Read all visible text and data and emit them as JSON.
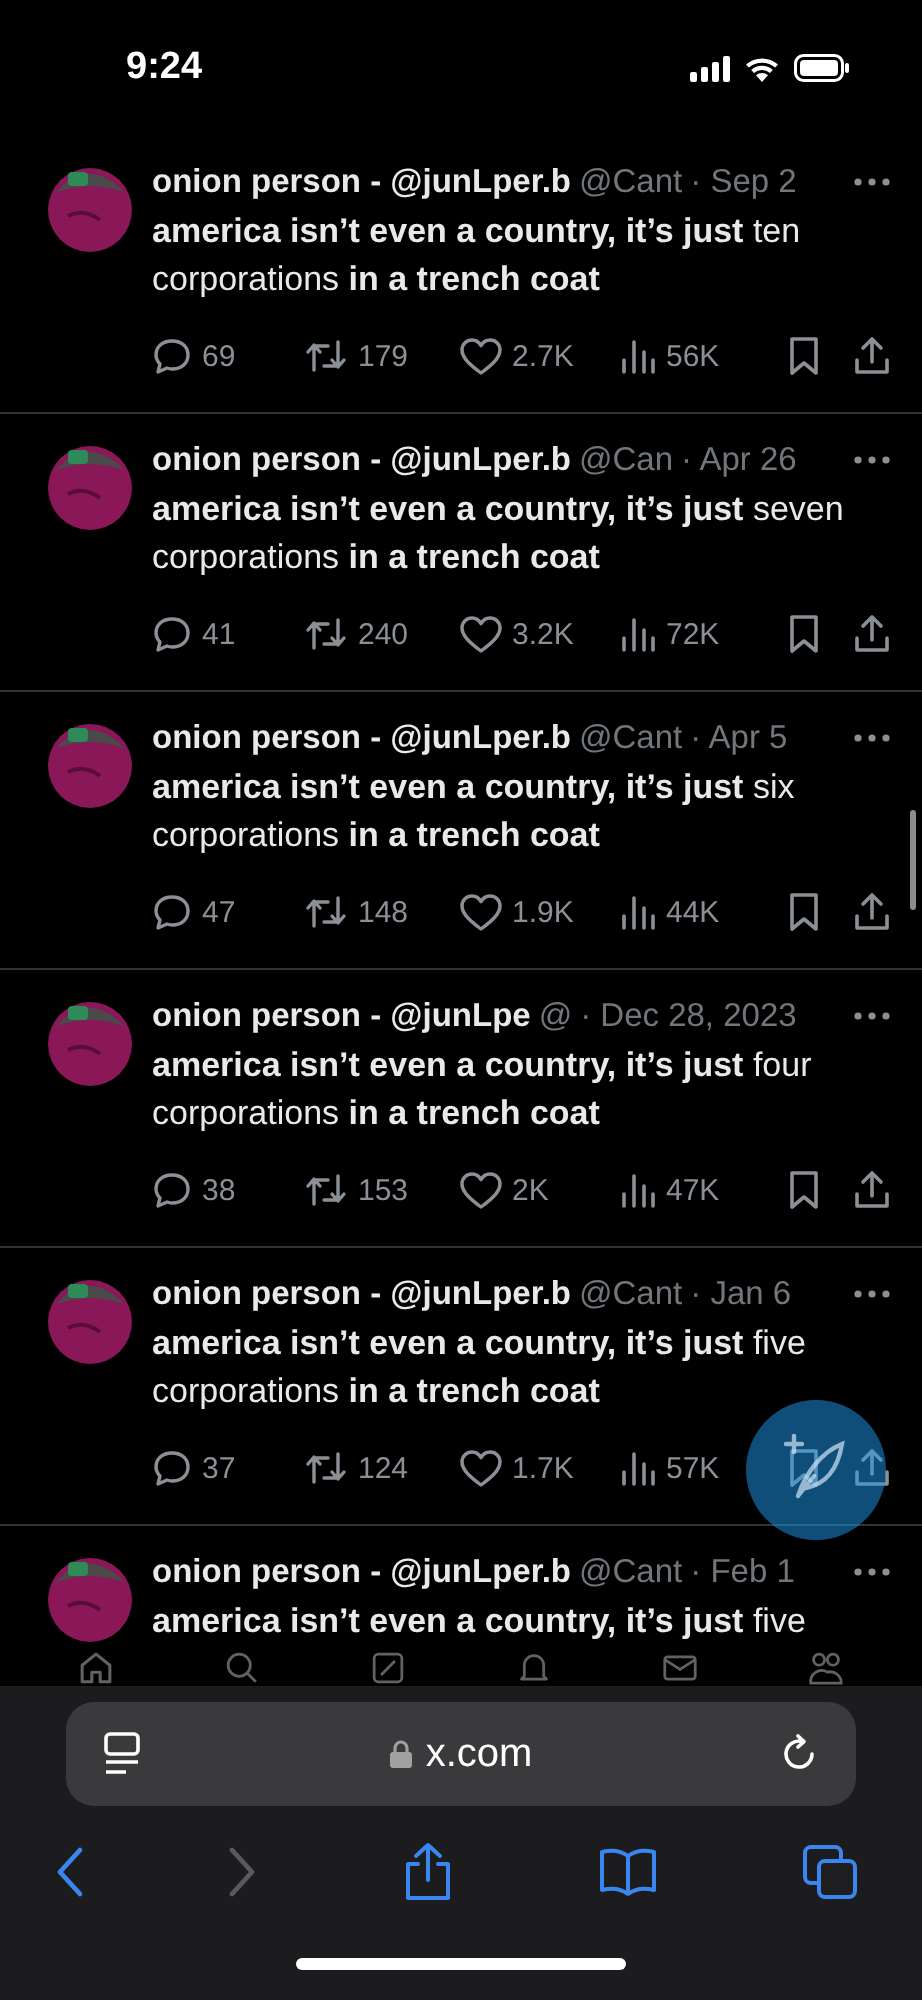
{
  "status_bar": {
    "time": "9:24"
  },
  "tweets": [
    {
      "name": "onion person - @junLper.b",
      "handle": "@Cant",
      "date": "· Sep 2",
      "text": "**america isn’t even a country, it’s just** ten corporations **in a trench coat**",
      "replies": "69",
      "reposts": "179",
      "likes": "2.7K",
      "views": "56K"
    },
    {
      "name": "onion person - @junLper.b",
      "handle": "@Can",
      "date": "· Apr 26",
      "text": "**america isn’t even a country, it’s just** seven corporations **in a trench coat**",
      "replies": "41",
      "reposts": "240",
      "likes": "3.2K",
      "views": "72K"
    },
    {
      "name": "onion person - @junLper.b",
      "handle": "@Cant",
      "date": "· Apr 5",
      "text": "**america isn’t even a country, it’s just** six corporations **in a trench coat**",
      "replies": "47",
      "reposts": "148",
      "likes": "1.9K",
      "views": "44K"
    },
    {
      "name": "onion person - @junLpe",
      "handle": "@",
      "date": "· Dec 28, 2023",
      "text": "**america isn’t even a country, it’s just** four corporations **in a trench coat**",
      "replies": "38",
      "reposts": "153",
      "likes": "2K",
      "views": "47K"
    },
    {
      "name": "onion person - @junLper.b",
      "handle": "@Cant",
      "date": "· Jan 6",
      "text": "**america isn’t even a country, it’s just** five corporations **in a trench coat**",
      "replies": "37",
      "reposts": "124",
      "likes": "1.7K",
      "views": "57K"
    },
    {
      "name": "onion person - @junLper.b",
      "handle": "@Cant",
      "date": "· Feb 1",
      "text": "**america isn’t even a country, it’s just** five"
    }
  ],
  "browser": {
    "url": "x.com",
    "toolbar": [
      {
        "kind": "back",
        "disabled": false
      },
      {
        "kind": "forward",
        "disabled": true
      },
      {
        "kind": "share",
        "disabled": false
      },
      {
        "kind": "bookmarks",
        "disabled": false
      },
      {
        "kind": "tabs",
        "disabled": false
      }
    ]
  }
}
